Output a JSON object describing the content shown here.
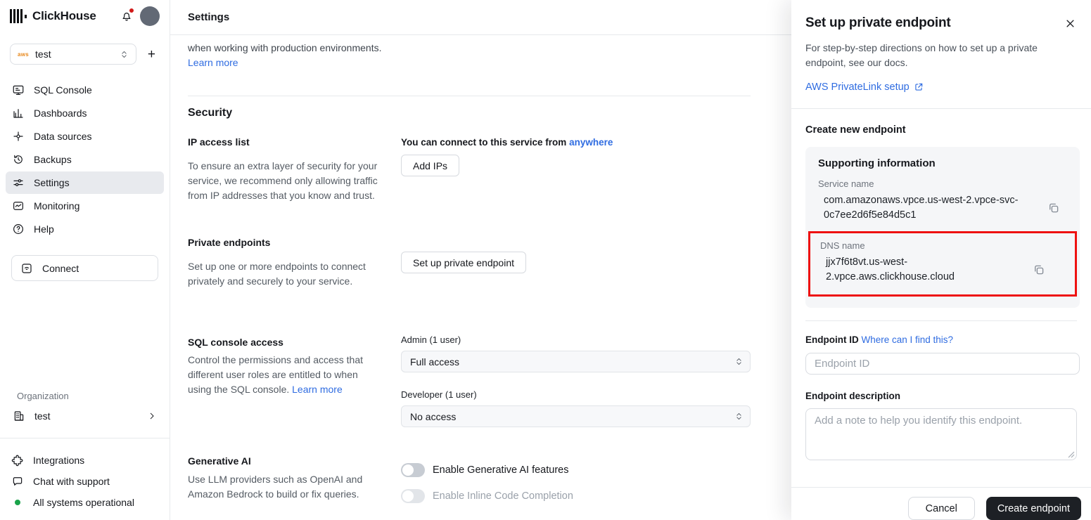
{
  "colors": {
    "accent": "#2f6ce1",
    "highlight_red": "#ee1111",
    "status_green": "#1aa34a"
  },
  "sidebar": {
    "brand": "ClickHouse",
    "service_selector": {
      "provider": "aws",
      "value": "test"
    },
    "nav": [
      {
        "label": "SQL Console"
      },
      {
        "label": "Dashboards"
      },
      {
        "label": "Data sources"
      },
      {
        "label": "Backups"
      },
      {
        "label": "Settings"
      },
      {
        "label": "Monitoring"
      },
      {
        "label": "Help"
      }
    ],
    "connect_label": "Connect",
    "organization_label": "Organization",
    "organization_name": "test",
    "footer": {
      "integrations": "Integrations",
      "chat": "Chat with support",
      "status": "All systems operational"
    }
  },
  "header": {
    "title": "Settings"
  },
  "main": {
    "intro": {
      "text": "when working with production environments.",
      "link": "Learn more"
    },
    "security_title": "Security",
    "ip_access": {
      "title": "IP access list",
      "body": "To ensure an extra layer of security for your service, we recommend only allowing traffic from IP addresses that you know and trust.",
      "connect_prefix": "You can connect to this service from",
      "connect_link": "anywhere",
      "add_ips_button": "Add IPs"
    },
    "private_endpoints": {
      "title": "Private endpoints",
      "body": "Set up one or more endpoints to connect privately and securely to your service.",
      "button": "Set up private endpoint"
    },
    "sql_access": {
      "title": "SQL console access",
      "body": "Control the permissions and access that different user roles are entitled to when using the SQL console.",
      "link": "Learn more",
      "admin_label": "Admin (1 user)",
      "admin_value": "Full access",
      "developer_label": "Developer (1 user)",
      "developer_value": "No access"
    },
    "generative_ai": {
      "title": "Generative AI",
      "body": "Use LLM providers such as OpenAI and Amazon Bedrock to build or fix queries.",
      "toggle_genai": "Enable Generative AI features",
      "toggle_inline": "Enable Inline Code Completion"
    }
  },
  "panel": {
    "title": "Set up private endpoint",
    "description": "For step-by-step directions on how to set up a private endpoint, see our docs.",
    "docs_link": "AWS PrivateLink setup",
    "create_heading": "Create new endpoint",
    "supporting_title": "Supporting information",
    "service_name_label": "Service name",
    "service_name_value": "com.amazonaws.vpce.us-west-2.vpce-svc-0c7ee2d6f5e84d5c1",
    "dns_label": "DNS name",
    "dns_value": "jjx7f6t8vt.us-west-2.vpce.aws.clickhouse.cloud",
    "endpoint_id_label": "Endpoint ID",
    "endpoint_id_help": "Where can I find this?",
    "endpoint_id_placeholder": "Endpoint ID",
    "description_label": "Endpoint description",
    "description_placeholder": "Add a note to help you identify this endpoint.",
    "cancel_button": "Cancel",
    "create_button": "Create endpoint"
  }
}
